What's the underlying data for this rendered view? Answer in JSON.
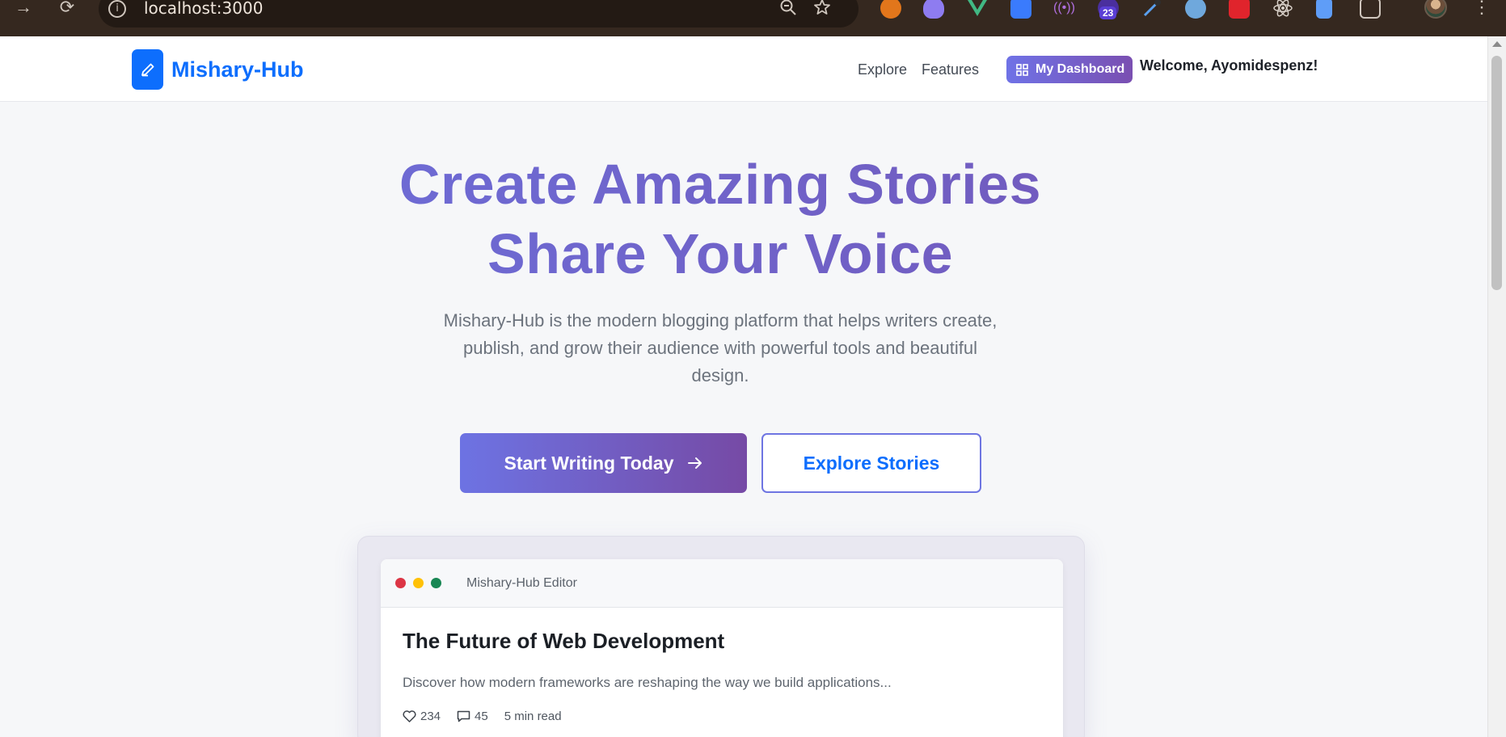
{
  "browser": {
    "url": "localhost:3000",
    "extension_badge": "23"
  },
  "header": {
    "brand_name": "Mishary-Hub",
    "nav": [
      "Explore",
      "Features"
    ],
    "dashboard_label": "My Dashboard",
    "welcome_text": "Welcome, Ayomidespenz!"
  },
  "hero": {
    "title_line1": "Create Amazing Stories",
    "title_line2": "Share Your Voice",
    "subtitle": "Mishary-Hub is the modern blogging platform that helps writers create, publish, and grow their audience with powerful tools and beautiful design.",
    "primary_cta": "Start Writing Today",
    "secondary_cta": "Explore Stories"
  },
  "preview": {
    "window_title": "Mishary-Hub Editor",
    "post_title": "The Future of Web Development",
    "post_excerpt": "Discover how modern frameworks are reshaping the way we build applications...",
    "likes": "234",
    "comments": "45",
    "read_time": "5 min read"
  },
  "colors": {
    "brand_blue": "#0d6efd",
    "gradient_start": "#6b73e0",
    "gradient_end": "#7453b3",
    "dot_red": "#dc3545",
    "dot_yellow": "#ffc107",
    "dot_green": "#198754"
  }
}
